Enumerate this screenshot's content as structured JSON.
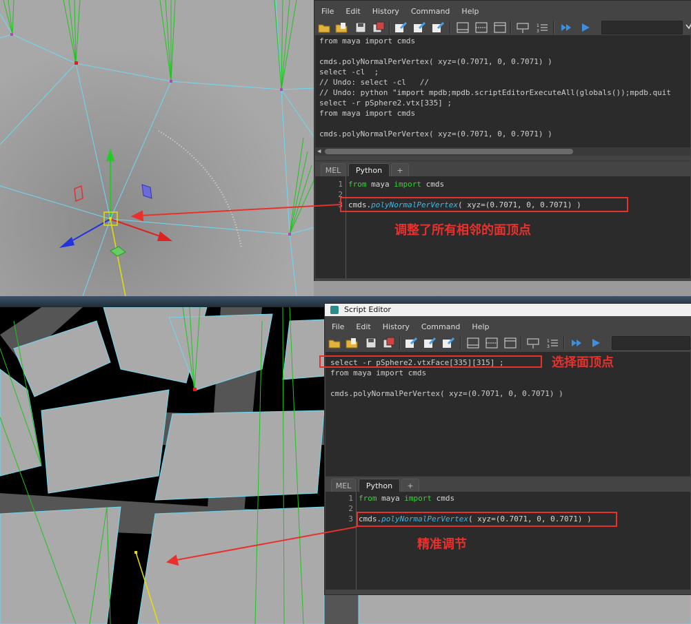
{
  "top_editor": {
    "menu": [
      "File",
      "Edit",
      "History",
      "Command",
      "Help"
    ],
    "history_lines": [
      "from maya import cmds",
      "",
      "cmds.polyNormalPerVertex( xyz=(0.7071, 0, 0.7071) )",
      "select -cl  ;",
      "// Undo: select -cl   //",
      "// Undo: python \"import mpdb;mpdb.scriptEditorExecuteAll(globals());mpdb.quit",
      "select -r pSphere2.vtx[335] ;",
      "from maya import cmds",
      "",
      "cmds.polyNormalPerVertex( xyz=(0.7071, 0, 0.7071) )"
    ],
    "tabs": [
      "MEL",
      "Python",
      "+"
    ],
    "line_numbers": [
      "1",
      "2",
      "3"
    ],
    "code": {
      "l1_kw1": "from",
      "l1_mid": " maya ",
      "l1_kw2": "import",
      "l1_end": " cmds",
      "l3_pre": "cmds.",
      "l3_fn": "polyNormalPerVertex",
      "l3_args": "( xyz=(0.7071, 0, 0.7071) )"
    },
    "annotation": "调整了所有相邻的面顶点"
  },
  "bottom_editor": {
    "title": "Script Editor",
    "menu": [
      "File",
      "Edit",
      "History",
      "Command",
      "Help"
    ],
    "history_lines": [
      "select -r pSphere2.vtxFace[335][315] ;",
      "from maya import cmds",
      "",
      "cmds.polyNormalPerVertex( xyz=(0.7071, 0, 0.7071) )"
    ],
    "tabs": [
      "MEL",
      "Python",
      "+"
    ],
    "line_numbers": [
      "1",
      "2",
      "3"
    ],
    "code": {
      "l1_kw1": "from",
      "l1_mid": " maya ",
      "l1_kw2": "import",
      "l1_end": " cmds",
      "l3_pre": "cmds.",
      "l3_fn": "polyNormalPerVertex",
      "l3_args": "( xyz=(0.7071, 0, 0.7071) )"
    },
    "annotation_select": "选择面顶点",
    "annotation_adjust": "精准调节"
  },
  "colors": {
    "annotation_red": "#e8302d",
    "wire_cyan": "#6fd9f0",
    "normal_green": "#1fc31f",
    "keyword_green": "#36d43a",
    "function_blue": "#3fb8e6"
  },
  "icons": [
    "open-folder-icon",
    "open-script-icon",
    "save-icon",
    "save-all-icon",
    "clear-history-icon",
    "clear-input-icon",
    "clear-all-icon",
    "layout-history-icon",
    "layout-split-icon",
    "layout-input-icon",
    "echo-icon",
    "line-numbers-icon",
    "execute-all-icon",
    "execute-icon"
  ]
}
